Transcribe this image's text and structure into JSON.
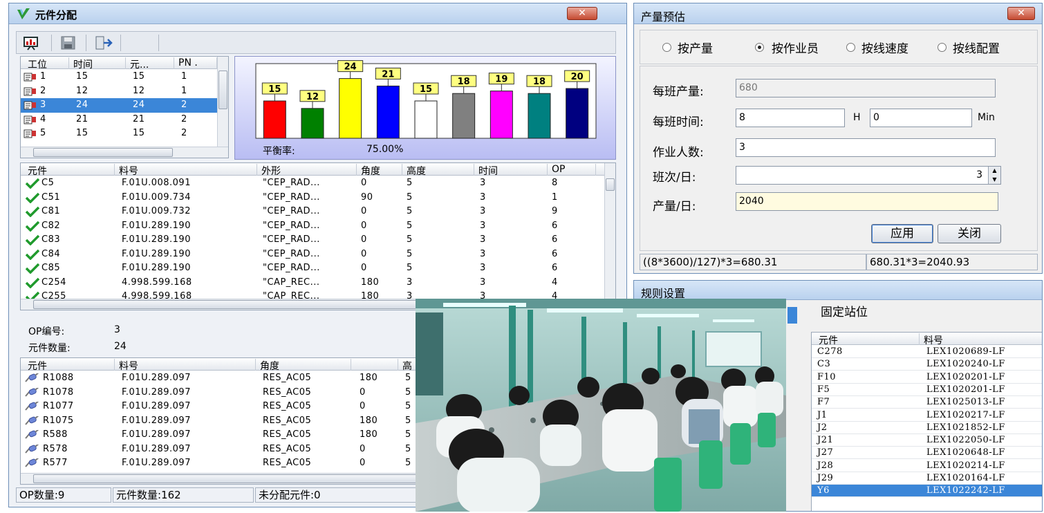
{
  "left_window": {
    "title": "元件分配",
    "close_label": "✕",
    "station_list": {
      "headers": [
        "工位",
        "时间",
        "元...",
        "PN ."
      ],
      "rows": [
        [
          "1",
          "15",
          "15",
          "1"
        ],
        [
          "2",
          "12",
          "12",
          "1"
        ],
        [
          "3",
          "24",
          "24",
          "2"
        ],
        [
          "4",
          "21",
          "21",
          "2"
        ],
        [
          "5",
          "15",
          "15",
          "2"
        ]
      ],
      "selected_index": 2
    },
    "chart_data": {
      "type": "bar",
      "values": [
        15,
        12,
        24,
        21,
        15,
        18,
        19,
        18,
        20
      ],
      "colors": [
        "#ff0000",
        "#008000",
        "#ffff00",
        "#0000ff",
        "#ffffff",
        "#808080",
        "#ff00ff",
        "#008080",
        "#000080"
      ],
      "balance_label": "平衡率:",
      "balance_value": "75.00%"
    },
    "component_table": {
      "headers": [
        "元件",
        "料号",
        "外形",
        "角度",
        "高度",
        "时间",
        "OP"
      ],
      "rows": [
        [
          "C5",
          "F.01U.008.091",
          "\"CEP_RAD...",
          "0",
          "5",
          "3",
          "8"
        ],
        [
          "C51",
          "F.01U.009.734",
          "\"CEP_RAD...",
          "90",
          "5",
          "3",
          "1"
        ],
        [
          "C81",
          "F.01U.009.732",
          "\"CEP_RAD...",
          "0",
          "5",
          "3",
          "9"
        ],
        [
          "C82",
          "F.01U.289.190",
          "\"CEP_RAD...",
          "0",
          "5",
          "3",
          "6"
        ],
        [
          "C83",
          "F.01U.289.190",
          "\"CEP_RAD...",
          "0",
          "5",
          "3",
          "6"
        ],
        [
          "C84",
          "F.01U.289.190",
          "\"CEP_RAD...",
          "0",
          "5",
          "3",
          "6"
        ],
        [
          "C85",
          "F.01U.289.190",
          "\"CEP_RAD...",
          "0",
          "5",
          "3",
          "6"
        ],
        [
          "C254",
          "4.998.599.168",
          "\"CAP_REC...",
          "180",
          "3",
          "3",
          "4"
        ],
        [
          "C255",
          "4.998.599.168",
          "\"CAP_REC...",
          "180",
          "3",
          "3",
          "4"
        ]
      ]
    },
    "op_info": {
      "op_label": "OP编号:",
      "op_value": "3",
      "count_label": "元件数量:",
      "count_value": "24"
    },
    "op_table": {
      "headers": [
        "元件",
        "料号",
        "角度",
        "",
        "高"
      ],
      "rows": [
        [
          "R1088",
          "F.01U.289.097",
          "RES_AC05",
          "180",
          "5"
        ],
        [
          "R1078",
          "F.01U.289.097",
          "RES_AC05",
          "0",
          "5"
        ],
        [
          "R1077",
          "F.01U.289.097",
          "RES_AC05",
          "0",
          "5"
        ],
        [
          "R1075",
          "F.01U.289.097",
          "RES_AC05",
          "180",
          "5"
        ],
        [
          "R588",
          "F.01U.289.097",
          "RES_AC05",
          "180",
          "5"
        ],
        [
          "R578",
          "F.01U.289.097",
          "RES_AC05",
          "0",
          "5"
        ],
        [
          "R577",
          "F.01U.289.097",
          "RES_AC05",
          "0",
          "5"
        ]
      ]
    },
    "status": {
      "op_count": "OP数量:9",
      "component_count": "元件数量:162",
      "unassigned": "未分配元件:0"
    }
  },
  "estimate_window": {
    "title": "产量预估",
    "close_label": "✕",
    "radios": [
      {
        "label": "按产量",
        "checked": false
      },
      {
        "label": "按作业员",
        "checked": true
      },
      {
        "label": "按线速度",
        "checked": false
      },
      {
        "label": "按线配置",
        "checked": false
      }
    ],
    "shift_output_label": "每班产量:",
    "shift_output_value": "680",
    "shift_time_label": "每班时间:",
    "hours_value": "8",
    "hours_unit": "H",
    "minutes_value": "0",
    "minutes_unit": "Min",
    "operators_label": "作业人数:",
    "operators_value": "3",
    "shifts_label": "班次/日:",
    "shifts_value": "3",
    "daily_output_label": "产量/日:",
    "daily_output_value": "2040",
    "apply_label": "应用",
    "close_button_label": "关闭",
    "formula_left": "((8*3600)/127)*3=680.31",
    "formula_right": "680.31*3=2040.93"
  },
  "rules_window": {
    "title": "规则设置",
    "tab_label": "固定站位",
    "headers": [
      "元件",
      "料号"
    ],
    "rows": [
      [
        "C278",
        "LEX1020689-LF"
      ],
      [
        "C3",
        "LEX1020240-LF"
      ],
      [
        "F10",
        "LEX1020201-LF"
      ],
      [
        "F5",
        "LEX1020201-LF"
      ],
      [
        "F7",
        "LEX1025013-LF"
      ],
      [
        "J1",
        "LEX1020217-LF"
      ],
      [
        "J2",
        "LEX1021852-LF"
      ],
      [
        "J21",
        "LEX1022050-LF"
      ],
      [
        "J27",
        "LEX1020648-LF"
      ],
      [
        "J28",
        "LEX1020214-LF"
      ],
      [
        "J29",
        "LEX1020164-LF"
      ],
      [
        "Y6",
        "LEX1022242-LF"
      ]
    ],
    "selected_index": 11
  },
  "icons": {
    "app": "app-logo-icon",
    "toolbar": [
      "chart-icon",
      "save-icon",
      "exit-icon"
    ],
    "check": "check-icon",
    "resistor": "component-icon"
  }
}
